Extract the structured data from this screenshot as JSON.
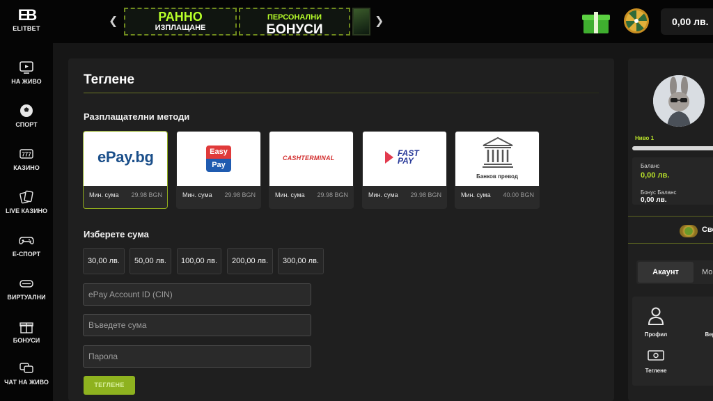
{
  "brand": {
    "mark": "EB",
    "name": "ELITBET"
  },
  "header": {
    "promos": [
      {
        "line1": "РАННО",
        "line2": "ИЗПЛАЩАНЕ"
      },
      {
        "line1": "ПЕРСОНАЛНИ",
        "line2": "БОНУСИ"
      }
    ],
    "balance": "0,00 лв."
  },
  "sidebar": {
    "items": [
      {
        "label": "НА ЖИВО",
        "icon": "tv-play-icon"
      },
      {
        "label": "СПОРТ",
        "icon": "soccer-ball-icon"
      },
      {
        "label": "КАЗИНО",
        "icon": "slot-777-icon"
      },
      {
        "label": "LIVE КАЗИНО",
        "icon": "cards-icon"
      },
      {
        "label": "Е-СПОРТ",
        "icon": "gamepad-icon"
      },
      {
        "label": "ВИРТУАЛНИ",
        "icon": "vr-headset-icon"
      },
      {
        "label": "БОНУСИ",
        "icon": "gift-icon"
      },
      {
        "label": "ЧАТ НА ЖИВО",
        "icon": "chat-icon"
      }
    ]
  },
  "main": {
    "title": "Теглене",
    "methods_label": "Разплащателни методи",
    "methods": [
      {
        "name": "ePay.bg",
        "min_label": "Мин. сума",
        "min_value": "29.98 BGN"
      },
      {
        "name_top": "Easy",
        "name_bottom": "Pay",
        "min_label": "Мин. сума",
        "min_value": "29.98 BGN"
      },
      {
        "name": "CASHTERMINAL",
        "min_label": "Мин. сума",
        "min_value": "29.98 BGN"
      },
      {
        "name_top": "FAST",
        "name_bottom": "PAY",
        "min_label": "Мин. сума",
        "min_value": "29.98 BGN"
      },
      {
        "name": "Банков превод",
        "min_label": "Мин. сума",
        "min_value": "40.00 BGN"
      }
    ],
    "amount_label": "Изберете сума",
    "amounts": [
      "30,00 лв.",
      "50,00 лв.",
      "100,00 лв.",
      "200,00 лв.",
      "300,00 лв."
    ],
    "fields": {
      "account_placeholder": "ePay Account ID (CIN)",
      "amount_placeholder": "Въведете сума",
      "password_placeholder": "Парола"
    },
    "submit_label": "ТЕГЛЕНЕ"
  },
  "profile": {
    "level": "Ниво 1",
    "level_progress": 0,
    "balance_label": "Баланс",
    "balance_value": "0,00 лв.",
    "bonus_label": "Бонус Баланс",
    "bonus_value": "0,00 лв.",
    "all_partial": "Сво",
    "tab_active": "Акаунт",
    "tab_more": "Мо",
    "grid": [
      {
        "label": "Профил",
        "icon": "user-icon"
      },
      {
        "label": "Вер",
        "icon": "verify-icon"
      },
      {
        "label": "Теглене",
        "icon": "cash-icon"
      },
      {
        "label": "",
        "icon": "more-icon"
      }
    ]
  },
  "colors": {
    "accent": "#8eb21f",
    "lime": "#b7e02a",
    "panel": "#1f1f1f",
    "sidebar": "#050505"
  }
}
